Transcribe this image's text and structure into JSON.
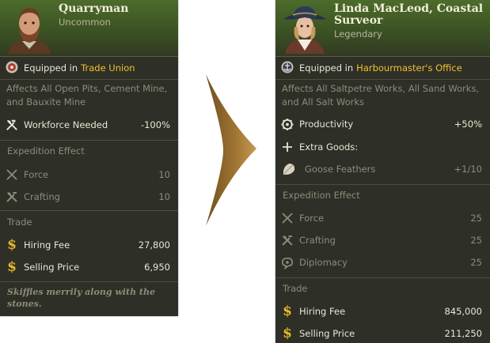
{
  "left_card": {
    "name": "Quarryman",
    "rarity": "Uncommon",
    "equipped_prefix": "Equipped in",
    "equipped_location": "Trade Union",
    "affects": "Affects All Open Pits, Cement Mine, and Bauxite Mine",
    "effects": [
      {
        "icon": "hammer-pick-icon",
        "label": "Workforce Needed",
        "value": "-100%"
      }
    ],
    "expedition_title": "Expedition Effect",
    "expedition": [
      {
        "icon": "crossed-swords-icon",
        "label": "Force",
        "value": "10"
      },
      {
        "icon": "tools-icon",
        "label": "Crafting",
        "value": "10"
      }
    ],
    "trade_title": "Trade",
    "trade": [
      {
        "icon": "dollar-icon",
        "label": "Hiring Fee",
        "value": "27,800"
      },
      {
        "icon": "dollar-icon",
        "label": "Selling Price",
        "value": "6,950"
      }
    ],
    "flavor": "Skiffles merrily along with the stones."
  },
  "right_card": {
    "name": "Linda MacLeod, Coastal Surveor",
    "rarity": "Legendary",
    "equipped_prefix": "Equipped in",
    "equipped_location": "Harbourmaster's Office",
    "affects": "Affects All Saltpetre Works, All Sand Works, and All Salt Works",
    "effects": [
      {
        "icon": "gear-icon",
        "label": "Productivity",
        "value": "+50%"
      },
      {
        "icon": "plus-icon",
        "label": "Extra Goods:",
        "value": ""
      },
      {
        "icon": "goose-feather-icon",
        "label": "Goose Feathers",
        "value": "+1/10"
      }
    ],
    "expedition_title": "Expedition Effect",
    "expedition": [
      {
        "icon": "crossed-swords-icon",
        "label": "Force",
        "value": "25"
      },
      {
        "icon": "tools-icon",
        "label": "Crafting",
        "value": "25"
      },
      {
        "icon": "speech-bubble-icon",
        "label": "Diplomacy",
        "value": "25"
      }
    ],
    "trade_title": "Trade",
    "trade": [
      {
        "icon": "dollar-icon",
        "label": "Hiring Fee",
        "value": "845,000"
      },
      {
        "icon": "dollar-icon",
        "label": "Selling Price",
        "value": "211,250"
      }
    ]
  },
  "colors": {
    "panel": "#2e2f27",
    "accent_gold": "#f2c12e",
    "dim_text": "#8f8b78",
    "arrow": "#a07633"
  }
}
